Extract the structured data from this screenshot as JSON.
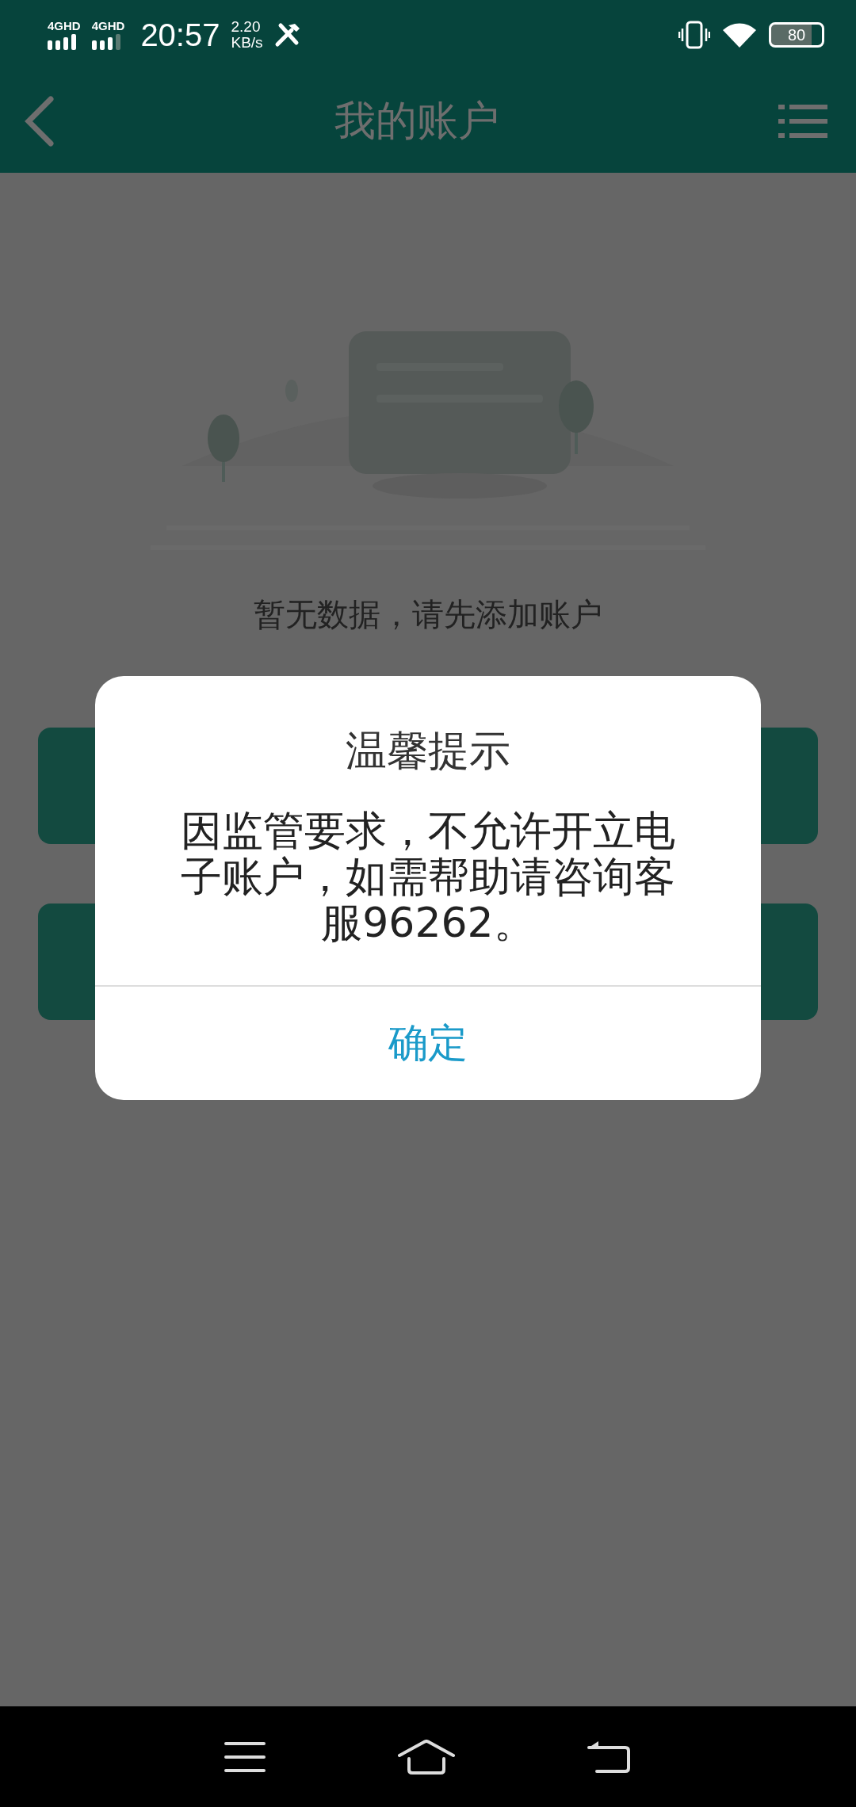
{
  "status_bar": {
    "signals": [
      {
        "label": "4G",
        "badge": "HD"
      },
      {
        "label": "4G",
        "badge": "HD"
      }
    ],
    "time": "20:57",
    "speed": "2.20",
    "speed_unit": "KB/s",
    "battery": "80"
  },
  "header": {
    "title": "我的账户"
  },
  "empty_state": {
    "kind": "picture",
    "message": "暂无数据，请先添加账户"
  },
  "buttons": [
    {
      "kind": "filled"
    },
    {
      "kind": "filled"
    }
  ],
  "dialog": {
    "title": "温馨提示",
    "message": "因监管要求，不允许开立电子账户，如需帮助请咨询客服96262。",
    "confirm": "确定"
  }
}
